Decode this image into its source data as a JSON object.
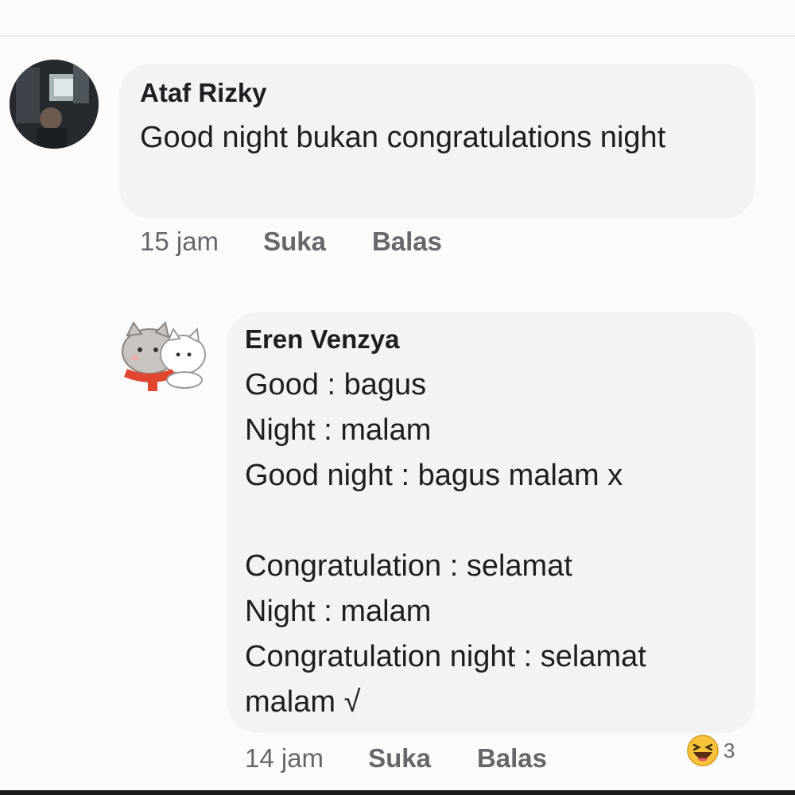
{
  "comments": [
    {
      "author": "Ataf Rizky",
      "text": "Good night bukan congratulations night",
      "time": "15 jam",
      "like_label": "Suka",
      "reply_label": "Balas",
      "avatar_icon": "user-photo-icon"
    },
    {
      "author": "Eren Venzya",
      "lines": [
        "Good : bagus",
        "Night : malam",
        "Good night : bagus malam x",
        "",
        "Congratulation : selamat",
        "Night : malam",
        "Congratulation night : selamat",
        "malam √"
      ],
      "time": "14 jam",
      "like_label": "Suka",
      "reply_label": "Balas",
      "avatar_icon": "cat-sticker-icon",
      "reaction": {
        "icon": "haha-emoji-icon",
        "count": "3"
      }
    }
  ]
}
